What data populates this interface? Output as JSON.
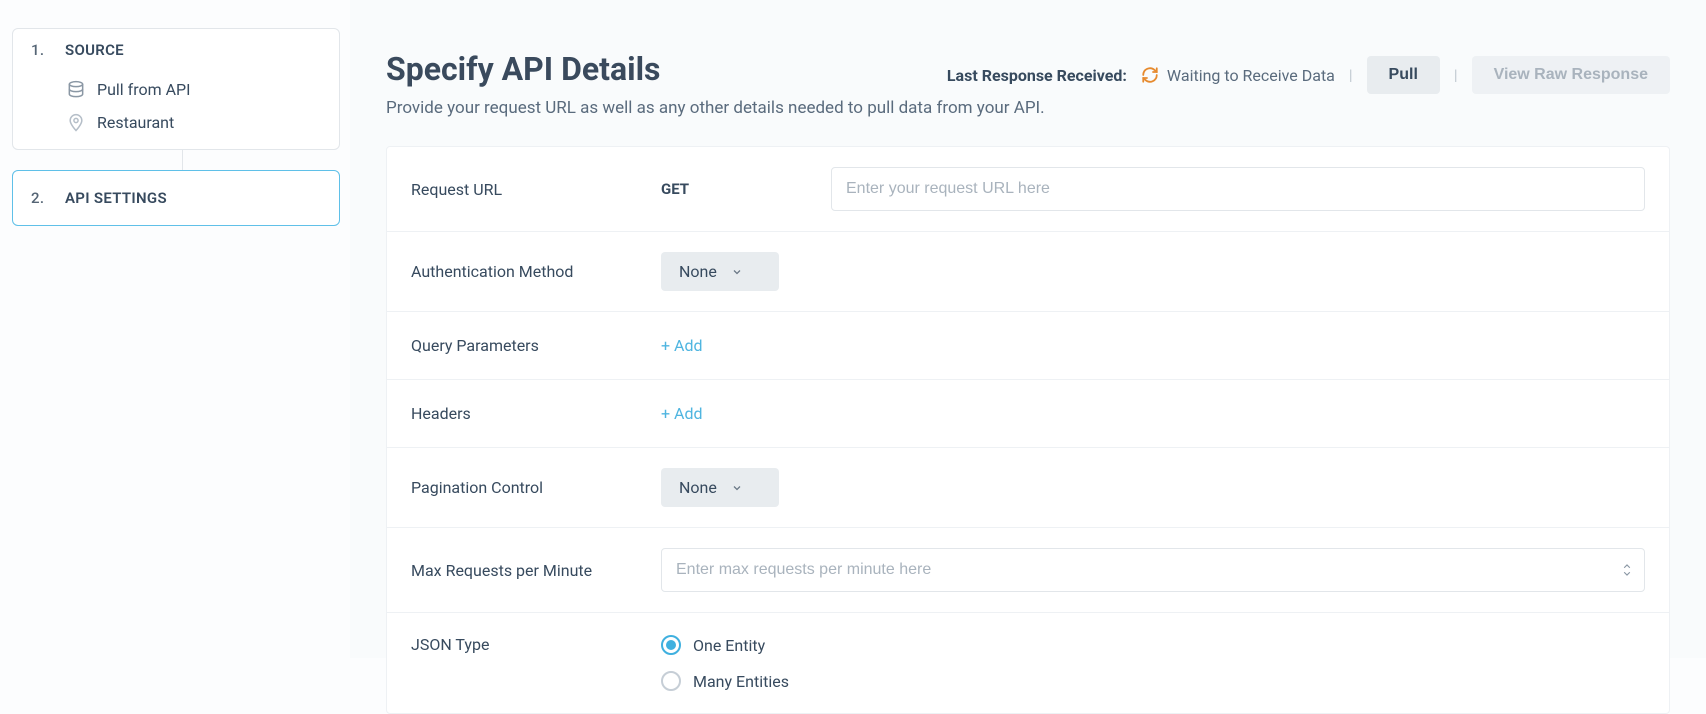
{
  "sidebar": {
    "step1": {
      "num": "1.",
      "label": "SOURCE"
    },
    "sub": [
      {
        "label": "Pull from API"
      },
      {
        "label": "Restaurant"
      }
    ],
    "step2": {
      "num": "2.",
      "label": "API SETTINGS"
    }
  },
  "header": {
    "title": "Specify API Details",
    "subtitle": "Provide your request URL as well as any other details needed to pull data from your API.",
    "last_response_label": "Last Response Received:",
    "status": "Waiting to Receive Data",
    "pull_label": "Pull",
    "view_raw_label": "View Raw Response"
  },
  "form": {
    "request_url": {
      "label": "Request URL",
      "method": "GET",
      "placeholder": "Enter your request URL here"
    },
    "auth": {
      "label": "Authentication Method",
      "value": "None"
    },
    "query": {
      "label": "Query Parameters",
      "add": "+ Add"
    },
    "headers": {
      "label": "Headers",
      "add": "+ Add"
    },
    "pagination": {
      "label": "Pagination Control",
      "value": "None"
    },
    "max_req": {
      "label": "Max Requests per Minute",
      "placeholder": "Enter max requests per minute here"
    },
    "json_type": {
      "label": "JSON Type",
      "options": [
        "One Entity",
        "Many Entities"
      ],
      "selected": "One Entity"
    }
  }
}
